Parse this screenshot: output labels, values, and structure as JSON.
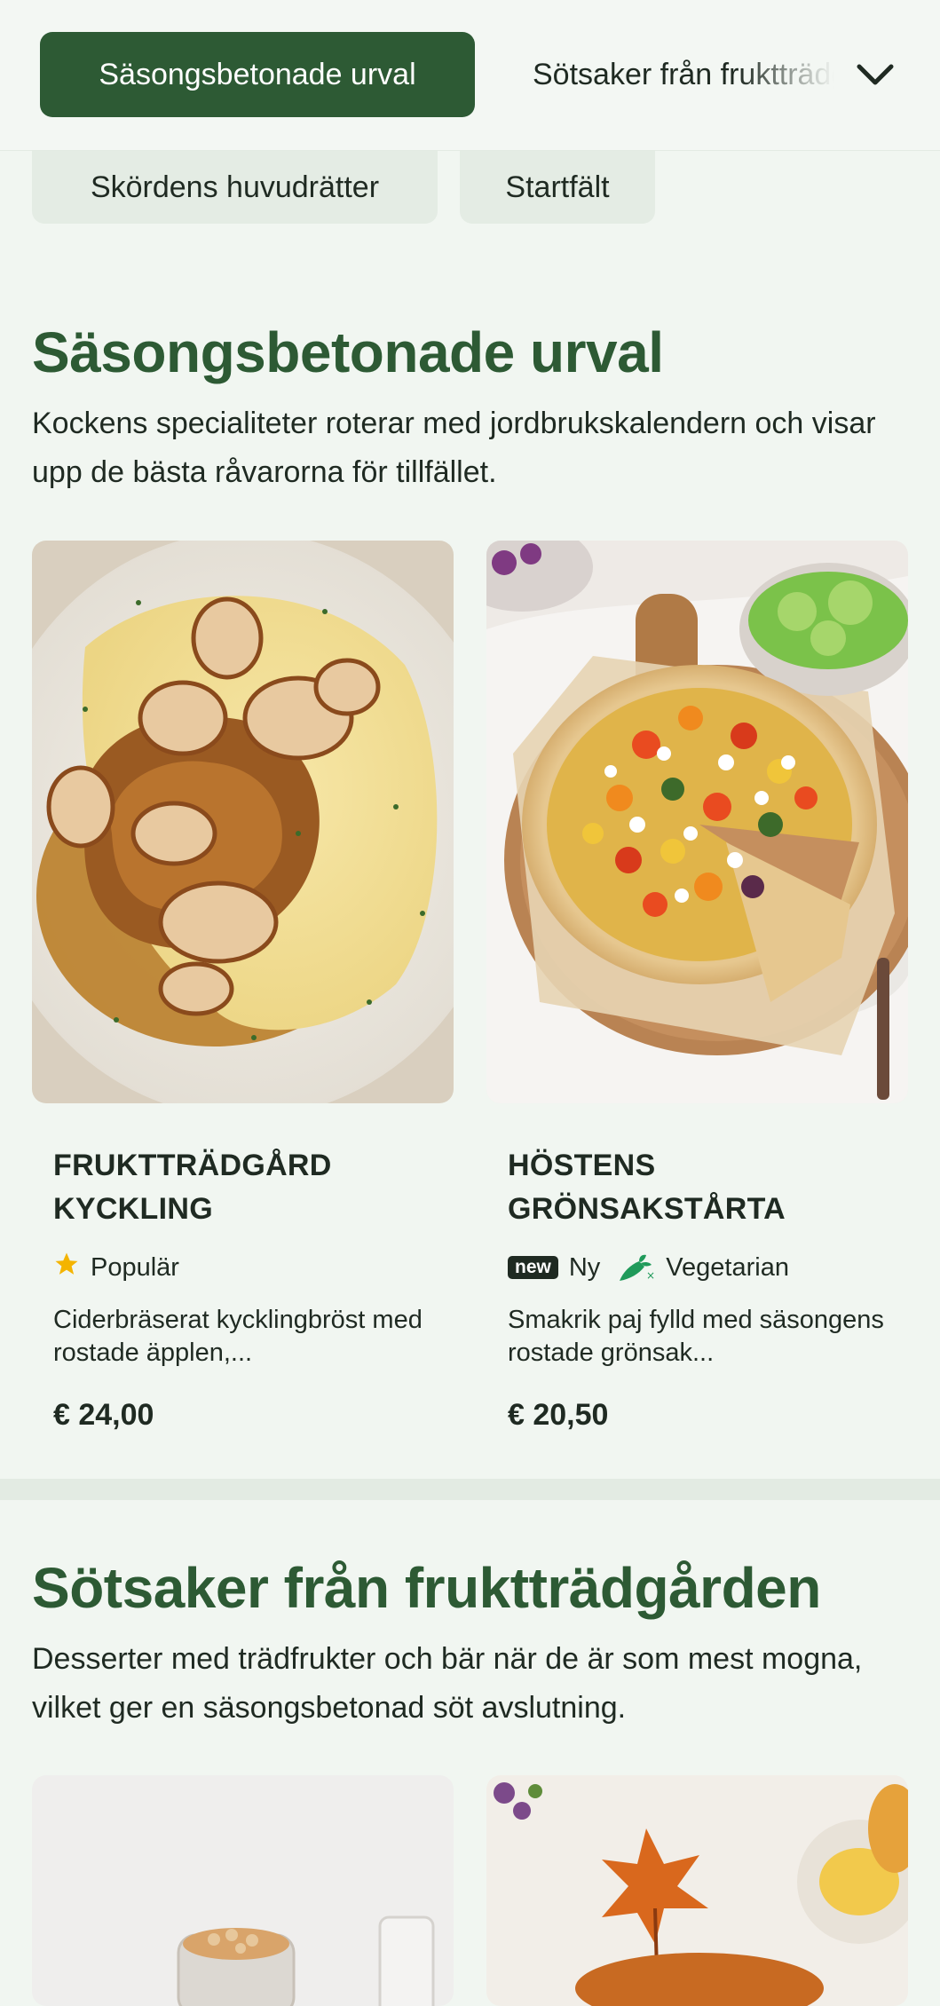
{
  "nav": {
    "active_tab": "Säsongsbetonade urval",
    "next_tab": "Sötsaker från fruktträdgården",
    "chips": [
      "Skördens huvudrätter",
      "Startfält"
    ]
  },
  "sections": [
    {
      "title": "Säsongsbetonade urval",
      "description": "Kockens specialiteter roterar med jordbrukskalendern och visar upp de bästa råvarorna för tillfället.",
      "items": [
        {
          "name": "FRUKTTRÄDGÅRD KYCKLING",
          "tags": [
            {
              "icon": "star-icon",
              "label": "Populär"
            }
          ],
          "description": "Ciderbräserat kycklingbröst med rostade äpplen,...",
          "price": "€ 24,00"
        },
        {
          "name": "HÖSTENS GRÖNSAKSTÅRTA",
          "tags": [
            {
              "icon": "new-badge",
              "badge": "new",
              "label": "Ny"
            },
            {
              "icon": "vegetarian-carrot-icon",
              "label": "Vegetarian"
            }
          ],
          "description": "Smakrik paj fylld med säsongens rostade grönsak...",
          "price": "€ 20,50"
        }
      ]
    },
    {
      "title": "Sötsaker från fruktträdgården",
      "description": "Desserter med trädfrukter och bär när de är som mest mogna, vilket ger en säsongsbetonad söt avslutning."
    }
  ],
  "colors": {
    "brand_green": "#2d5a34",
    "background": "#f1f6f1",
    "star": "#f4b400",
    "vegetarian": "#1f9a5a"
  }
}
